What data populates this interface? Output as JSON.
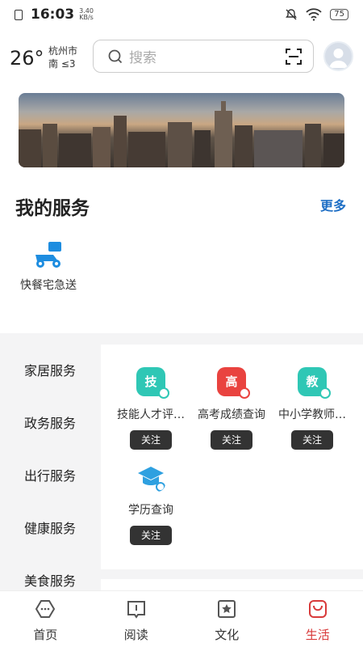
{
  "status": {
    "time": "16:03",
    "speed": "3.40",
    "speed_unit": "KB/s",
    "battery": "75"
  },
  "weather": {
    "temp": "26°",
    "city": "杭州市",
    "wind": "南 ≤3"
  },
  "search": {
    "placeholder": "搜索"
  },
  "my_services": {
    "title": "我的服务",
    "more": "更多",
    "items": [
      {
        "label": "快餐宅急送",
        "icon": "delivery-scooter-icon"
      }
    ]
  },
  "categories": [
    "家居服务",
    "政务服务",
    "出行服务",
    "健康服务",
    "美食服务"
  ],
  "services": [
    {
      "name": "技能人才评…",
      "icon_text": "技",
      "color": "#2fc7b5",
      "follow": "关注"
    },
    {
      "name": "高考成绩查询",
      "icon_text": "高",
      "color": "#e9433f",
      "follow": "关注"
    },
    {
      "name": "中小学教师…",
      "icon_text": "教",
      "color": "#2fc7b5",
      "follow": "关注"
    },
    {
      "name": "学历查询",
      "icon": "graduation-cap-icon",
      "color": "#2ea0e0",
      "follow": "关注"
    }
  ],
  "nav": [
    {
      "label": "首页",
      "icon": "home-icon"
    },
    {
      "label": "阅读",
      "icon": "book-icon"
    },
    {
      "label": "文化",
      "icon": "star-icon"
    },
    {
      "label": "生活",
      "icon": "shopping-bag-icon",
      "active": true
    }
  ],
  "colors": {
    "accent": "#d83a3a",
    "link": "#1f6fc5"
  }
}
